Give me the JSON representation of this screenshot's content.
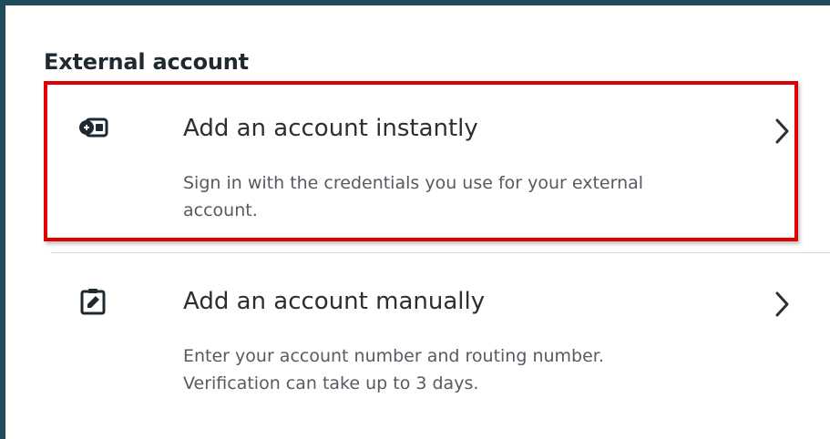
{
  "section": {
    "title": "External account"
  },
  "options": [
    {
      "title": "Add an account instantly",
      "description": "Sign in with the credentials you use for your external account.",
      "icon": "wallet-card-icon",
      "highlighted": true,
      "highlight_color": "#e00000"
    },
    {
      "title": "Add an account manually",
      "description": "Enter your account number and routing number. Verification can take up to 3 days.",
      "icon": "clipboard-edit-icon",
      "highlighted": false
    }
  ],
  "colors": {
    "frame_border": "#1f4e5a",
    "highlight": "#e00000",
    "title_text": "#2a2f33",
    "description_text": "#555b60"
  }
}
